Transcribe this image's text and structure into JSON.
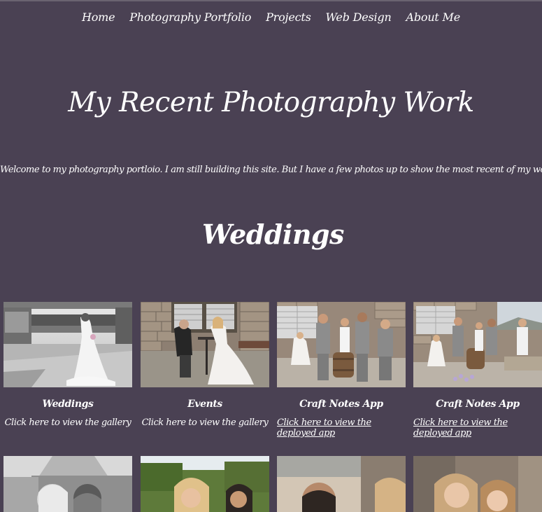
{
  "nav": {
    "items": [
      "Home",
      "Photography Portfolio",
      "Projects",
      "Web Design",
      "About Me"
    ]
  },
  "page": {
    "title": "My Recent Photography Work",
    "welcome": "Welcome to my photography portloio. I am still building this site. But I have a few photos up to show the most recent of my work.",
    "section_title": "Weddings"
  },
  "cards": [
    {
      "title": "Weddings",
      "link": "Click here to view the gallery",
      "photo": "bride-portrait-bw"
    },
    {
      "title": "Events",
      "link": "Click here to view the gallery",
      "photo": "couple-seated-at-table"
    },
    {
      "title": "Craft Notes App",
      "link": "Click here to view the deployed app",
      "photo": "groomsmen-with-bride"
    },
    {
      "title": "Craft Notes App",
      "link": "Click here to view the deployed app",
      "photo": "wedding-party-patio"
    }
  ],
  "row2_photos": [
    "couple-kiss-bw",
    "couple-portrait-garden",
    "groom-smiling",
    "bride-bridesmaid-closeup"
  ],
  "colors": {
    "background": "#4a4153",
    "text": "#ffffff"
  }
}
